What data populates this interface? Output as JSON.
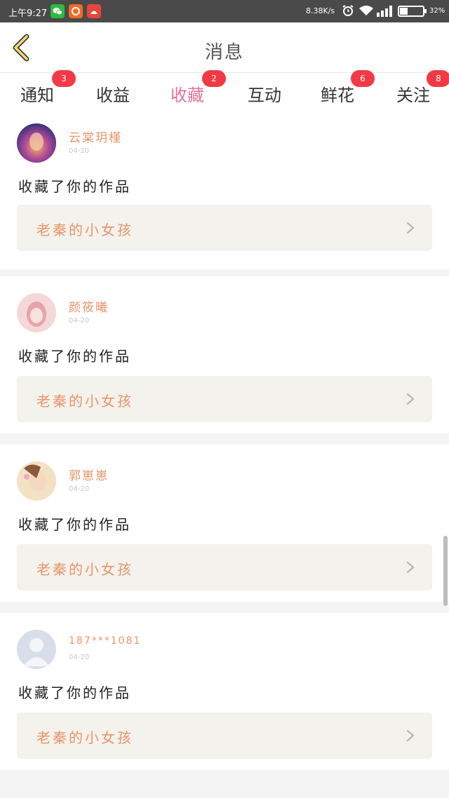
{
  "status_bar": {
    "time": "上午9:27",
    "network_speed": "8.38K/s",
    "battery": "32%"
  },
  "header": {
    "title": "消息"
  },
  "tabs": [
    {
      "label": "通知",
      "badge": "3"
    },
    {
      "label": "收益",
      "badge": ""
    },
    {
      "label": "收藏",
      "badge": "2",
      "active": true
    },
    {
      "label": "互动",
      "badge": ""
    },
    {
      "label": "鲜花",
      "badge": "6"
    },
    {
      "label": "关注",
      "badge": "8"
    }
  ],
  "messages": [
    {
      "username": "云棠玥槿",
      "date": "04-20",
      "action": "收藏了你的作品",
      "work_title": "老秦的小女孩"
    },
    {
      "username": "颜筱曦",
      "date": "04-20",
      "action": "收藏了你的作品",
      "work_title": "老秦的小女孩"
    },
    {
      "username": "郭崽崽",
      "date": "04-20",
      "action": "收藏了你的作品",
      "work_title": "老秦的小女孩"
    },
    {
      "username": "187***1081",
      "date": "04-20",
      "action": "收藏了你的作品",
      "work_title": "老秦的小女孩"
    }
  ],
  "colors": {
    "accent_pink": "#e0739b",
    "badge_red": "#f23a44",
    "name_orange": "#e8956a"
  }
}
